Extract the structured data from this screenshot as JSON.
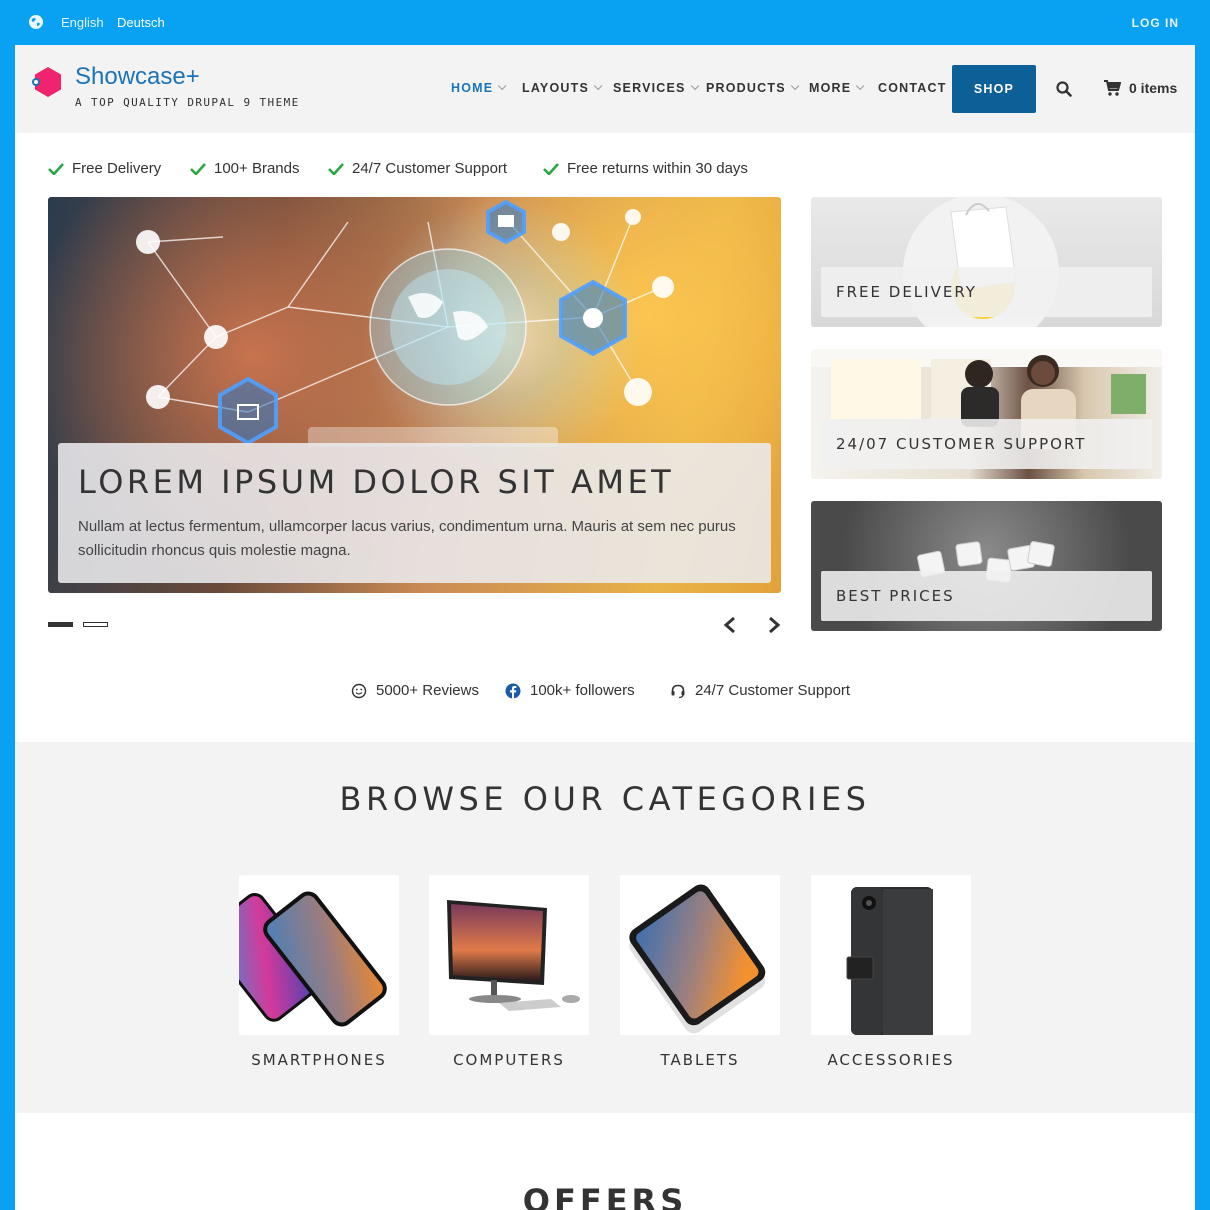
{
  "topbar": {
    "languages": [
      "English",
      "Deutsch"
    ],
    "login": "LOG IN"
  },
  "header": {
    "site_name": "Showcase+",
    "slogan": "A TOP QUALITY DRUPAL 9 THEME",
    "nav": [
      {
        "label": "HOME",
        "dropdown": true,
        "active": true
      },
      {
        "label": "LAYOUTS",
        "dropdown": true
      },
      {
        "label": "SERVICES",
        "dropdown": true
      },
      {
        "label": "PRODUCTS",
        "dropdown": true
      },
      {
        "label": "MORE",
        "dropdown": true
      },
      {
        "label": "CONTACT",
        "dropdown": false
      }
    ],
    "shop_button": "SHOP",
    "cart": "0 items"
  },
  "features": [
    "Free Delivery",
    "100+ Brands",
    "24/7 Customer Support",
    "Free returns within 30 days"
  ],
  "hero": {
    "title": "LOREM IPSUM DOLOR SIT AMET",
    "text": "Nullam at lectus fermentum, ullamcorper lacus varius, condimentum urna. Mauris at sem nec purus sollicitudin rhoncus quis molestie magna.",
    "slides": 2,
    "active_slide": 1
  },
  "promos": [
    "FREE DELIVERY",
    "24/07 CUSTOMER SUPPORT",
    "BEST PRICES"
  ],
  "stats": [
    "5000+ Reviews",
    "100k+ followers",
    "24/7 Customer Support"
  ],
  "categories": {
    "title": "BROWSE OUR CATEGORIES",
    "items": [
      "SMARTPHONES",
      "COMPUTERS",
      "TABLETS",
      "ACCESSORIES"
    ]
  },
  "offers_title": "OFFERS",
  "colors": {
    "frame": "#09a2f2",
    "brand_blue": "#1b73b9",
    "shop_button": "#0d5f97",
    "check_green": "#28a745",
    "logo_pink": "#f0246e"
  }
}
